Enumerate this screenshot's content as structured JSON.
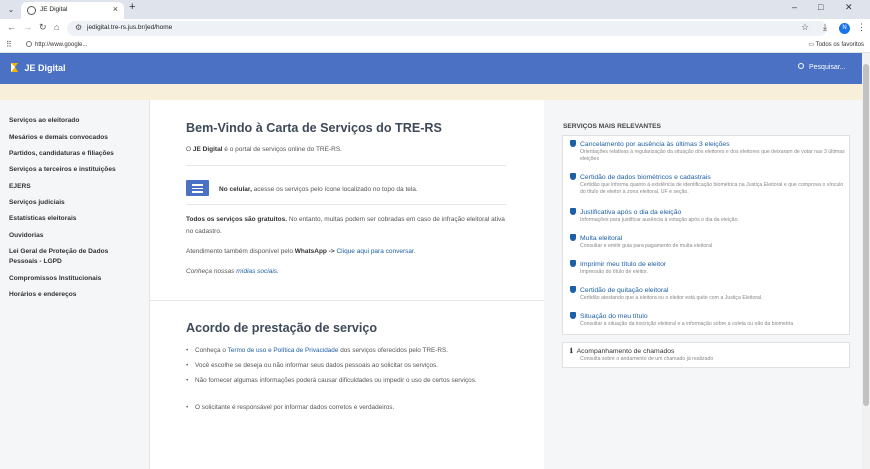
{
  "browser": {
    "tab_title": "JE Digital",
    "url": "jedigital.tre-rs.jus.br/jed/home",
    "bookmark": "http://www.google...",
    "all_bookmarks": "Todos os favoritos",
    "profile_initial": "N"
  },
  "header": {
    "logo": "JE Digital",
    "search_label": "Pesquisar..."
  },
  "sidebar": {
    "items": [
      "Serviços ao eleitorado",
      "Mesários e demais convocados",
      "Partidos, candidaturas e filiações",
      "Serviços a terceiros e instituições",
      "EJERS",
      "Serviços judiciais",
      "Estatísticas eleitorais",
      "Ouvidorias",
      "Lei Geral de Proteção de Dados Pessoais - LGPD",
      "Compromissos Institucionais",
      "Horários e endereços"
    ]
  },
  "main": {
    "title": "Bem-Vindo à Carta de Serviços do TRE-RS",
    "intro_pre": "O ",
    "intro_bold": "JE Digital",
    "intro_post": " é o portal de serviços online do TRE-RS.",
    "mobile_bold": "No celular,",
    "mobile_text": " acesse os serviços pelo ícone localizado no topo da tela.",
    "free_bold": "Todos os serviços são gratuitos.",
    "free_text": " No entanto, multas podem ser cobradas em caso de infração eleitoral ativa no cadastro.",
    "wa_pre": "Atendimento também disponível pelo ",
    "wa_bold": "WhatsApp ->",
    "wa_link": "Clique aqui para conversar",
    "wa_post": ".",
    "social_pre": "Conheça nossas ",
    "social_link": "mídias sociais",
    "social_post": ".",
    "agreement_title": "Acordo de prestação de serviço",
    "agreement": {
      "b1_pre": "Conheça o ",
      "b1_link1": "Termo de uso e Política de Privacidade",
      "b1_post": " dos serviços oferecidos pelo TRE-RS.",
      "b2": "Você escolhe se deseja ou não informar seus dados pessoais ao solicitar os serviços.",
      "b3": "Não fornecer algumas informações poderá causar dificuldades ou impedir o uso de certos serviços.",
      "b4": "O solicitante é responsável por informar dados corretos e verdadeiros."
    }
  },
  "relevant": {
    "title": "SERVIÇOS MAIS RELEVANTES",
    "items": [
      {
        "title": "Cancelamento por ausência às últimas 3 eleições",
        "desc": "Orientações relativas à regularização da situação dos eleitores e dos eleitores que deixaram de votar nas 3 últimas eleições"
      },
      {
        "title": "Certidão de dados biométricos e cadastrais",
        "desc": "Certidão que informa quanto à existência de identificação biométrica na Justiça Eleitoral e que comprova o vínculo do título de eleitor à zona eleitoral, UF e seção."
      },
      {
        "title": "Justificativa após o dia da eleição",
        "desc": "Informações para justificar ausência à votação após o dia da eleição."
      },
      {
        "title": "Multa eleitoral",
        "desc": "Consultar e emitir guia para pagamento de multa eleitoral"
      },
      {
        "title": "Imprimir meu título de eleitor",
        "desc": "Impressão do título de eleitor."
      },
      {
        "title": "Certidão de quitação eleitoral",
        "desc": "Certidão atestando que a eleitora ou o eleitor está quite com a Justiça Eleitoral."
      },
      {
        "title": "Situação do meu título",
        "desc": "Consultar a situação da inscrição eleitoral e a informação sobre a coleta ou não da biometria"
      }
    ],
    "tracking": {
      "title": "Acompanhamento de chamados",
      "desc": "Consulta sobre o andamento de um chamado já realizado"
    }
  },
  "colors": {
    "header": "#4a71c4",
    "link": "#1d5fa6",
    "notice": "#f7efd9"
  }
}
